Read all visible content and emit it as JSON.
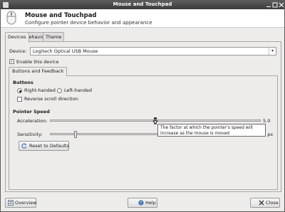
{
  "window": {
    "title": "Mouse and Touchpad"
  },
  "header": {
    "title": "Mouse and Touchpad",
    "subtitle": "Configure pointer device behavior and appearance"
  },
  "tabs": [
    {
      "label": "Devices",
      "active": true
    },
    {
      "label": "Behavior",
      "active": false
    },
    {
      "label": "Theme",
      "active": false
    }
  ],
  "device": {
    "label": "Device:",
    "selected": "Logitech Optical USB Mouse",
    "enable_label": "Enable this device",
    "enabled": true
  },
  "subtab": {
    "label": "Buttons and Feedback"
  },
  "buttons_section": {
    "title": "Buttons",
    "right_handed": "Right-handed",
    "left_handed": "Left-handed",
    "selected": "Right-handed",
    "reverse_scroll": "Reverse scroll direction",
    "reverse_scroll_checked": false
  },
  "pointer_speed": {
    "title": "Pointer Speed",
    "acceleration_label": "Acceleration:",
    "acceleration_value": "5.0",
    "acceleration_fraction": 0.5,
    "sensitivity_label": "Sensitivity:",
    "sensitivity_value": "4 px",
    "sensitivity_fraction": 0.12,
    "reset_label": "Reset to Defaults"
  },
  "tooltip": {
    "text": "The factor at which the pointer's speed will increase as the mouse is moved"
  },
  "footer": {
    "overview": "Overview",
    "help": "Help",
    "close": "Close"
  },
  "colors": {
    "titlebar": "#3a3a3a",
    "panel": "#edeceb",
    "accent": "#3d6fb5"
  }
}
